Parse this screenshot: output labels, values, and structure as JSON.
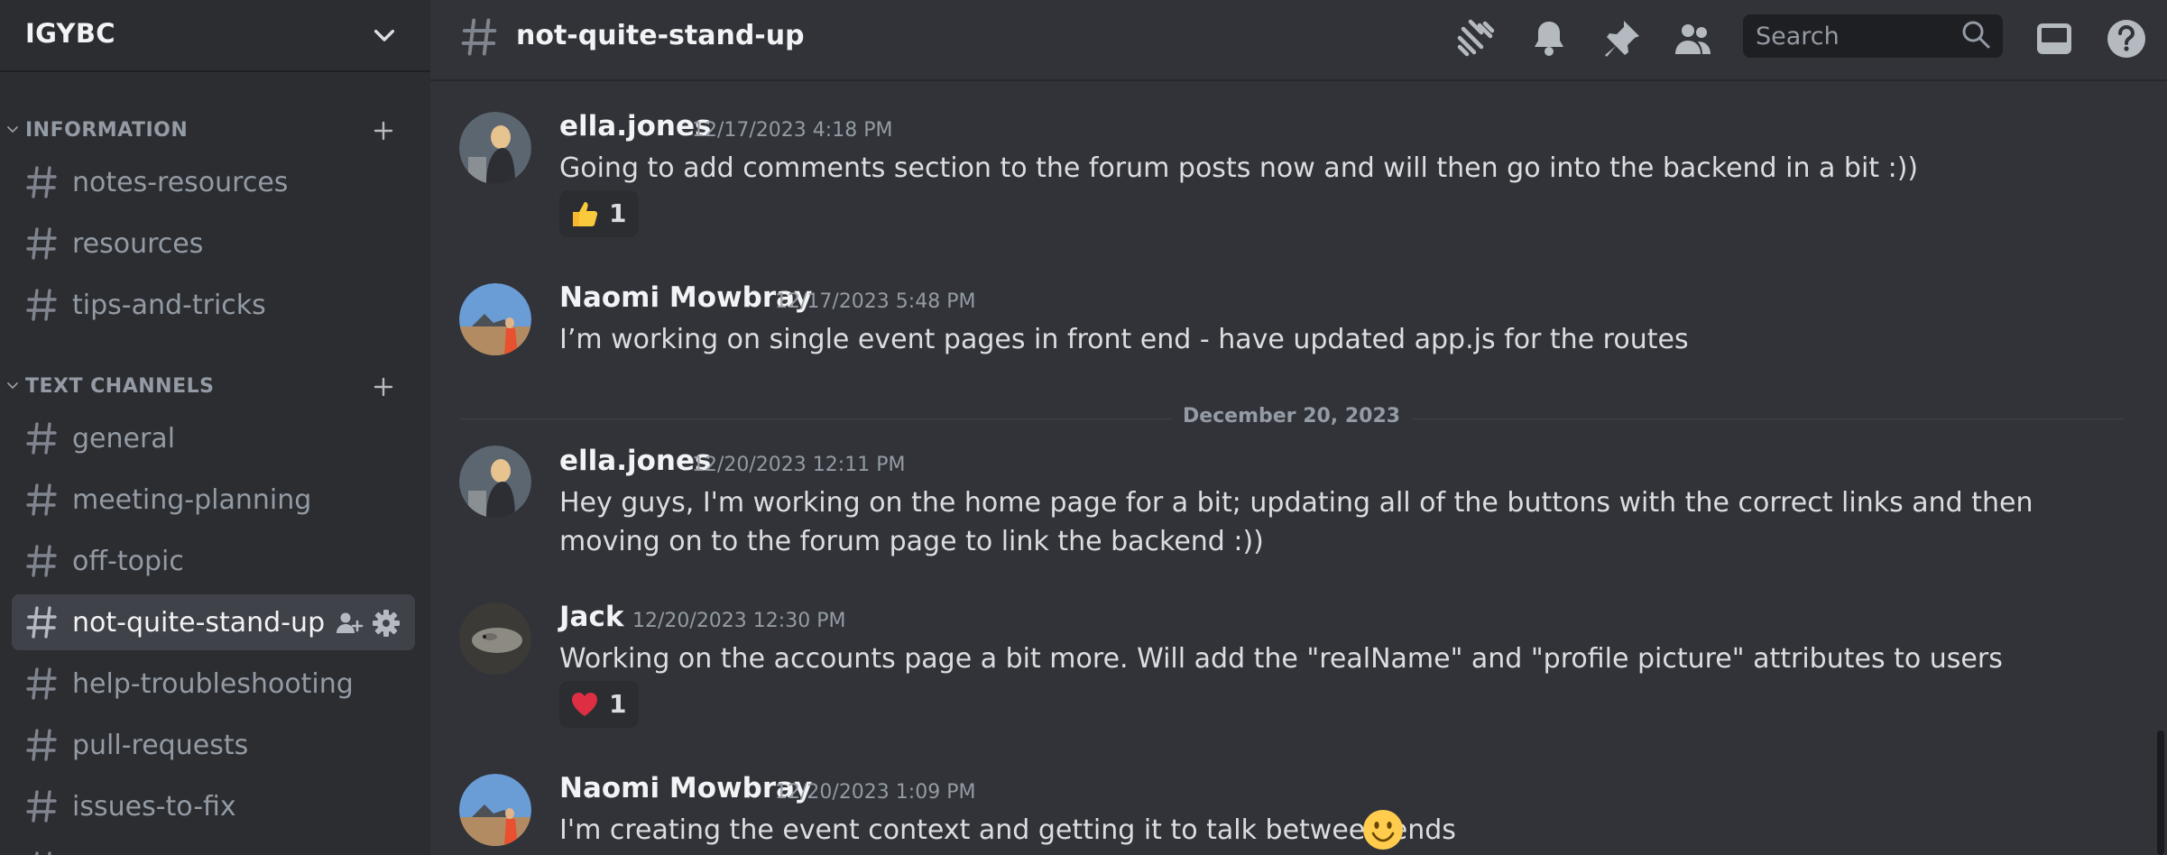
{
  "server": {
    "name": "IGYBC"
  },
  "categories": [
    {
      "label": "INFORMATION"
    },
    {
      "label": "TEXT CHANNELS"
    }
  ],
  "channels_info": [
    {
      "label": "notes-resources"
    },
    {
      "label": "resources"
    },
    {
      "label": "tips-and-tricks"
    }
  ],
  "channels_text": [
    {
      "label": "general"
    },
    {
      "label": "meeting-planning"
    },
    {
      "label": "off-topic"
    },
    {
      "label": "not-quite-stand-up"
    },
    {
      "label": "help-troubleshooting"
    },
    {
      "label": "pull-requests"
    },
    {
      "label": "issues-to-fix"
    }
  ],
  "header": {
    "channel_title": "not-quite-stand-up",
    "search_placeholder": "Search",
    "icons": [
      "threads-icon",
      "bell-icon",
      "pin-icon",
      "members-icon",
      "search-icon",
      "inbox-icon",
      "help-icon"
    ]
  },
  "messages": [
    {
      "author": "ella.jones",
      "time": "12/17/2023 4:18 PM",
      "text": "Going to add comments section to the forum posts now and will then go into the backend in a bit :))",
      "reaction": {
        "emoji": "thumbs-up",
        "count": "1"
      }
    },
    {
      "author": "Naomi Mowbray",
      "time": "12/17/2023 5:48 PM",
      "text": "I’m working on single event pages in front end - have updated app.js for the routes"
    },
    {
      "author": "ella.jones",
      "time": "12/20/2023 12:11 PM",
      "text": "Hey guys, I'm working on the home page for a bit; updating all of the buttons with the correct links and then moving on to the forum page to link the backend :))"
    },
    {
      "author": "Jack",
      "time": "12/20/2023 12:30 PM",
      "text": "Working on the accounts page a bit more. Will add the \"realName\" and \"profile picture\" attributes to users",
      "reaction": {
        "emoji": "heart",
        "count": "1"
      }
    },
    {
      "author": "Naomi Mowbray",
      "time": "12/20/2023 1:09 PM",
      "text": "I'm creating the event context and getting it to talk between ends"
    }
  ],
  "date_divider": "December 20, 2023",
  "colors": {
    "sidebar": "#2b2d31",
    "main": "#313338",
    "active_channel": "#404249",
    "muted_text": "#949ba4"
  }
}
